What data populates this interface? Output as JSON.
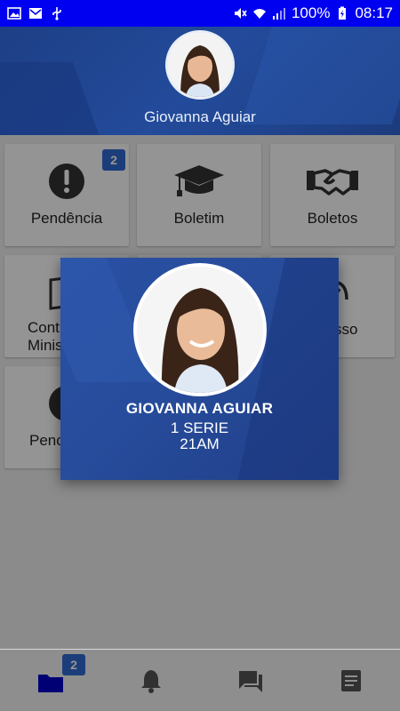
{
  "status_bar": {
    "battery": "100%",
    "time": "08:17",
    "bg_color": "#0000f0",
    "icons": [
      "image-icon",
      "mail-icon",
      "usb-icon",
      "mute-icon",
      "wifi-icon",
      "signal-icon",
      "battery-icon"
    ]
  },
  "header": {
    "user_name": "Giovanna Aguiar"
  },
  "tiles": [
    {
      "label": "Pendência",
      "icon": "exclamation-circle-icon",
      "badge": "2"
    },
    {
      "label": "Boletim",
      "icon": "graduation-cap-icon"
    },
    {
      "label": "Boletos",
      "icon": "handshake-icon"
    },
    {
      "label": "Cont\nMinis",
      "icon": "book-icon"
    },
    {
      "label": "sso",
      "icon": "partial-icon"
    },
    {
      "label": "Penc",
      "icon": "partial-circle-icon"
    }
  ],
  "modal": {
    "name": "GIOVANNA AGUIAR",
    "grade": "1 SERIE",
    "class": "21AM"
  },
  "bottom_nav": {
    "items": [
      {
        "icon": "folder-icon",
        "badge": "2",
        "active": true
      },
      {
        "icon": "bell-icon"
      },
      {
        "icon": "chat-icon"
      },
      {
        "icon": "document-icon"
      }
    ]
  },
  "colors": {
    "accent": "#2f6bd3",
    "header_blue": "#234b9b",
    "active_nav": "#0000c8"
  }
}
